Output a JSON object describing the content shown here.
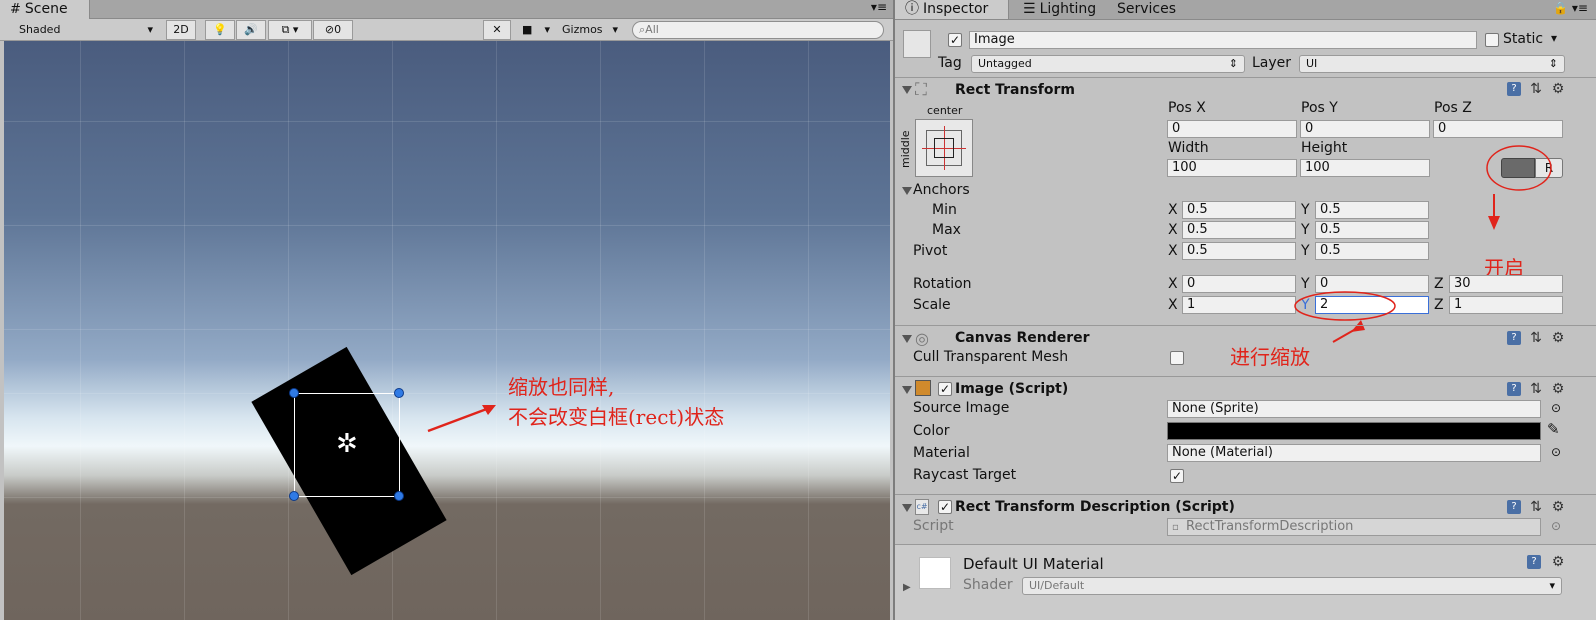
{
  "scene": {
    "tab_label": "Scene",
    "shading_mode": "Shaded",
    "mode_2d": "2D",
    "effects_count": "0",
    "gizmos_label": "Gizmos",
    "search_placeholder": "All"
  },
  "scene_annotation": {
    "line1": "缩放也同样,",
    "line2": "不会改变白框(rect)状态"
  },
  "inspector": {
    "tabs": [
      "Inspector",
      "Lighting",
      "Services"
    ],
    "object_name": "Image",
    "static_label": "Static",
    "tag_label": "Tag",
    "tag_value": "Untagged",
    "layer_label": "Layer",
    "layer_value": "UI",
    "rect_transform": {
      "title": "Rect Transform",
      "anchor_h": "center",
      "anchor_v": "middle",
      "pos_x_label": "Pos X",
      "pos_x": "0",
      "pos_y_label": "Pos Y",
      "pos_y": "0",
      "pos_z_label": "Pos Z",
      "pos_z": "0",
      "width_label": "Width",
      "width": "100",
      "height_label": "Height",
      "height": "100",
      "raw_edit_label": "R",
      "anchors_label": "Anchors",
      "min_label": "Min",
      "min_x": "0.5",
      "min_y": "0.5",
      "max_label": "Max",
      "max_x": "0.5",
      "max_y": "0.5",
      "pivot_label": "Pivot",
      "pivot_x": "0.5",
      "pivot_y": "0.5",
      "rotation_label": "Rotation",
      "rot_x": "0",
      "rot_y": "0",
      "rot_z": "30",
      "scale_label": "Scale",
      "scale_x": "1",
      "scale_y": "2",
      "scale_z": "1",
      "axis_x": "X",
      "axis_y": "Y",
      "axis_z": "Z"
    },
    "canvas_renderer": {
      "title": "Canvas Renderer",
      "cull_label": "Cull Transparent Mesh"
    },
    "image_script": {
      "title": "Image (Script)",
      "source_image_label": "Source Image",
      "source_image": "None (Sprite)",
      "color_label": "Color",
      "material_label": "Material",
      "material": "None (Material)",
      "raycast_label": "Raycast Target"
    },
    "rtd_script": {
      "title": "Rect Transform Description (Script)",
      "script_label": "Script",
      "script_value": "RectTransformDescription"
    },
    "material_footer": {
      "name": "Default UI Material",
      "shader_label": "Shader",
      "shader_value": "UI/Default"
    }
  },
  "inspector_annotations": {
    "enable": "开启",
    "scaling": "进行缩放"
  },
  "colors": {
    "annotation_red": "#e0241b",
    "color_swatch": "#000000",
    "rotated_image": "#000000"
  }
}
